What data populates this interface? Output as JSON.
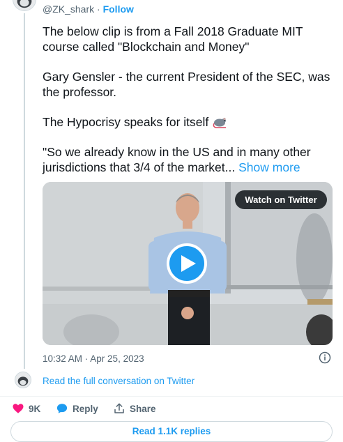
{
  "tweet": {
    "handle": "@ZK_shark",
    "separator": " · ",
    "follow_label": "Follow",
    "paragraphs": [
      "The below clip is from a Fall 2018 Graduate MIT course called \"Blockchain and Money\"",
      "Gary Gensler - the current President of the SEC, was the professor.",
      "The Hypocrisy speaks for itself"
    ],
    "last_paragraph": "\"So we already know in the US and in many other jurisdictions that 3/4 of the market...",
    "show_more_label": "Show more",
    "emoji": "rat-icon"
  },
  "media": {
    "watch_label": "Watch on Twitter",
    "play_icon": "play-icon"
  },
  "meta": {
    "timestamp": "10:32 AM · Apr 25, 2023",
    "read_conversation": "Read the full conversation on Twitter"
  },
  "actions": {
    "like_count": "9K",
    "reply_label": "Reply",
    "share_label": "Share",
    "read_replies_label": "Read 1.1K replies"
  },
  "colors": {
    "accent": "#1d9bf0",
    "like": "#f91880",
    "text": "#0f1419",
    "muted": "#536471"
  }
}
